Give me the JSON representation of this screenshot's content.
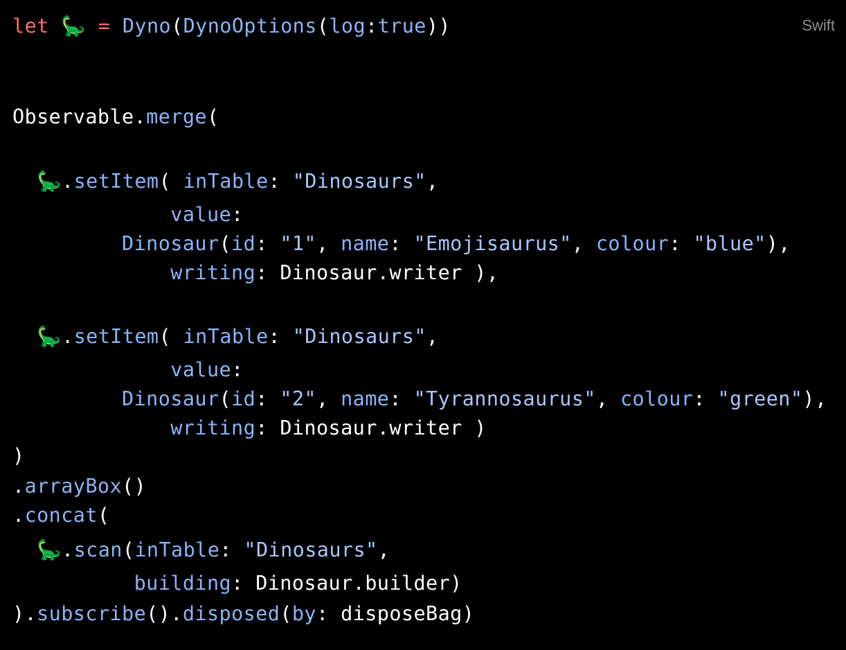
{
  "code_block": {
    "language": "Swift",
    "emoji": "🦕",
    "lines": [
      [
        {
          "t": "let",
          "c": "kw"
        },
        {
          "t": " ",
          "c": "plain"
        },
        {
          "t": "🦕",
          "c": "emo"
        },
        {
          "t": " ",
          "c": "plain"
        },
        {
          "t": "=",
          "c": "kw"
        },
        {
          "t": " ",
          "c": "plain"
        },
        {
          "t": "Dyno",
          "c": "fn"
        },
        {
          "t": "(",
          "c": "punc"
        },
        {
          "t": "DynoOptions",
          "c": "fn"
        },
        {
          "t": "(",
          "c": "punc"
        },
        {
          "t": "log",
          "c": "prm"
        },
        {
          "t": ":",
          "c": "punc"
        },
        {
          "t": "true",
          "c": "fn"
        },
        {
          "t": "))",
          "c": "punc"
        }
      ],
      [],
      [],
      [
        {
          "t": "Observable",
          "c": "plain"
        },
        {
          "t": ".",
          "c": "punc"
        },
        {
          "t": "merge",
          "c": "fn"
        },
        {
          "t": "(",
          "c": "punc"
        }
      ],
      [],
      [
        {
          "t": "  ",
          "c": "plain"
        },
        {
          "t": "🦕",
          "c": "emo"
        },
        {
          "t": ".",
          "c": "punc"
        },
        {
          "t": "setItem",
          "c": "fn"
        },
        {
          "t": "(",
          "c": "punc"
        },
        {
          "t": " ",
          "c": "plain"
        },
        {
          "t": "inTable",
          "c": "prm"
        },
        {
          "t": ": ",
          "c": "punc"
        },
        {
          "t": "\"Dinosaurs\"",
          "c": "str"
        },
        {
          "t": ",",
          "c": "punc"
        }
      ],
      [
        {
          "t": "             ",
          "c": "plain"
        },
        {
          "t": "value",
          "c": "prm"
        },
        {
          "t": ":",
          "c": "punc"
        }
      ],
      [
        {
          "t": "         ",
          "c": "plain"
        },
        {
          "t": "Dinosaur",
          "c": "fn"
        },
        {
          "t": "(",
          "c": "punc"
        },
        {
          "t": "id",
          "c": "prm"
        },
        {
          "t": ": ",
          "c": "punc"
        },
        {
          "t": "\"1\"",
          "c": "str"
        },
        {
          "t": ", ",
          "c": "punc"
        },
        {
          "t": "name",
          "c": "prm"
        },
        {
          "t": ": ",
          "c": "punc"
        },
        {
          "t": "\"Emojisaurus\"",
          "c": "str"
        },
        {
          "t": ", ",
          "c": "punc"
        },
        {
          "t": "colour",
          "c": "prm"
        },
        {
          "t": ": ",
          "c": "punc"
        },
        {
          "t": "\"blue\"",
          "c": "str"
        },
        {
          "t": "),",
          "c": "punc"
        }
      ],
      [
        {
          "t": "             ",
          "c": "plain"
        },
        {
          "t": "writing",
          "c": "prm"
        },
        {
          "t": ": ",
          "c": "punc"
        },
        {
          "t": "Dinosaur.writer )",
          "c": "plain"
        },
        {
          "t": ",",
          "c": "punc"
        }
      ],
      [],
      [
        {
          "t": "  ",
          "c": "plain"
        },
        {
          "t": "🦕",
          "c": "emo"
        },
        {
          "t": ".",
          "c": "punc"
        },
        {
          "t": "setItem",
          "c": "fn"
        },
        {
          "t": "(",
          "c": "punc"
        },
        {
          "t": " ",
          "c": "plain"
        },
        {
          "t": "inTable",
          "c": "prm"
        },
        {
          "t": ": ",
          "c": "punc"
        },
        {
          "t": "\"Dinosaurs\"",
          "c": "str"
        },
        {
          "t": ",",
          "c": "punc"
        }
      ],
      [
        {
          "t": "             ",
          "c": "plain"
        },
        {
          "t": "value",
          "c": "prm"
        },
        {
          "t": ":",
          "c": "punc"
        }
      ],
      [
        {
          "t": "         ",
          "c": "plain"
        },
        {
          "t": "Dinosaur",
          "c": "fn"
        },
        {
          "t": "(",
          "c": "punc"
        },
        {
          "t": "id",
          "c": "prm"
        },
        {
          "t": ": ",
          "c": "punc"
        },
        {
          "t": "\"2\"",
          "c": "str"
        },
        {
          "t": ", ",
          "c": "punc"
        },
        {
          "t": "name",
          "c": "prm"
        },
        {
          "t": ": ",
          "c": "punc"
        },
        {
          "t": "\"Tyrannosaurus\"",
          "c": "str"
        },
        {
          "t": ", ",
          "c": "punc"
        },
        {
          "t": "colour",
          "c": "prm"
        },
        {
          "t": ": ",
          "c": "punc"
        },
        {
          "t": "\"green\"",
          "c": "str"
        },
        {
          "t": "),",
          "c": "punc"
        }
      ],
      [
        {
          "t": "             ",
          "c": "plain"
        },
        {
          "t": "writing",
          "c": "prm"
        },
        {
          "t": ": ",
          "c": "punc"
        },
        {
          "t": "Dinosaur.writer )",
          "c": "plain"
        }
      ],
      [
        {
          "t": ")",
          "c": "punc"
        }
      ],
      [
        {
          "t": ".",
          "c": "punc"
        },
        {
          "t": "arrayBox",
          "c": "fn"
        },
        {
          "t": "()",
          "c": "punc"
        }
      ],
      [
        {
          "t": ".",
          "c": "punc"
        },
        {
          "t": "concat",
          "c": "fn"
        },
        {
          "t": "(",
          "c": "punc"
        }
      ],
      [
        {
          "t": "  ",
          "c": "plain"
        },
        {
          "t": "🦕",
          "c": "emo"
        },
        {
          "t": ".",
          "c": "punc"
        },
        {
          "t": "scan",
          "c": "fn"
        },
        {
          "t": "(",
          "c": "punc"
        },
        {
          "t": "inTable",
          "c": "prm"
        },
        {
          "t": ": ",
          "c": "punc"
        },
        {
          "t": "\"Dinosaurs\"",
          "c": "str"
        },
        {
          "t": ",",
          "c": "punc"
        }
      ],
      [
        {
          "t": "          ",
          "c": "plain"
        },
        {
          "t": "building",
          "c": "prm"
        },
        {
          "t": ": ",
          "c": "punc"
        },
        {
          "t": "Dinosaur.builder)",
          "c": "plain"
        }
      ],
      [
        {
          "t": ").",
          "c": "punc"
        },
        {
          "t": "subscribe",
          "c": "fn"
        },
        {
          "t": "().",
          "c": "punc"
        },
        {
          "t": "disposed",
          "c": "fn"
        },
        {
          "t": "(",
          "c": "punc"
        },
        {
          "t": "by",
          "c": "prm"
        },
        {
          "t": ": ",
          "c": "punc"
        },
        {
          "t": "disposeBag)",
          "c": "plain"
        }
      ]
    ]
  },
  "colors": {
    "background": "#000000",
    "keyword": "#ff6b72",
    "function": "#8ab4f8",
    "string": "#a8c7fa",
    "plain": "#ffffff",
    "language_label": "#8e8e93"
  }
}
